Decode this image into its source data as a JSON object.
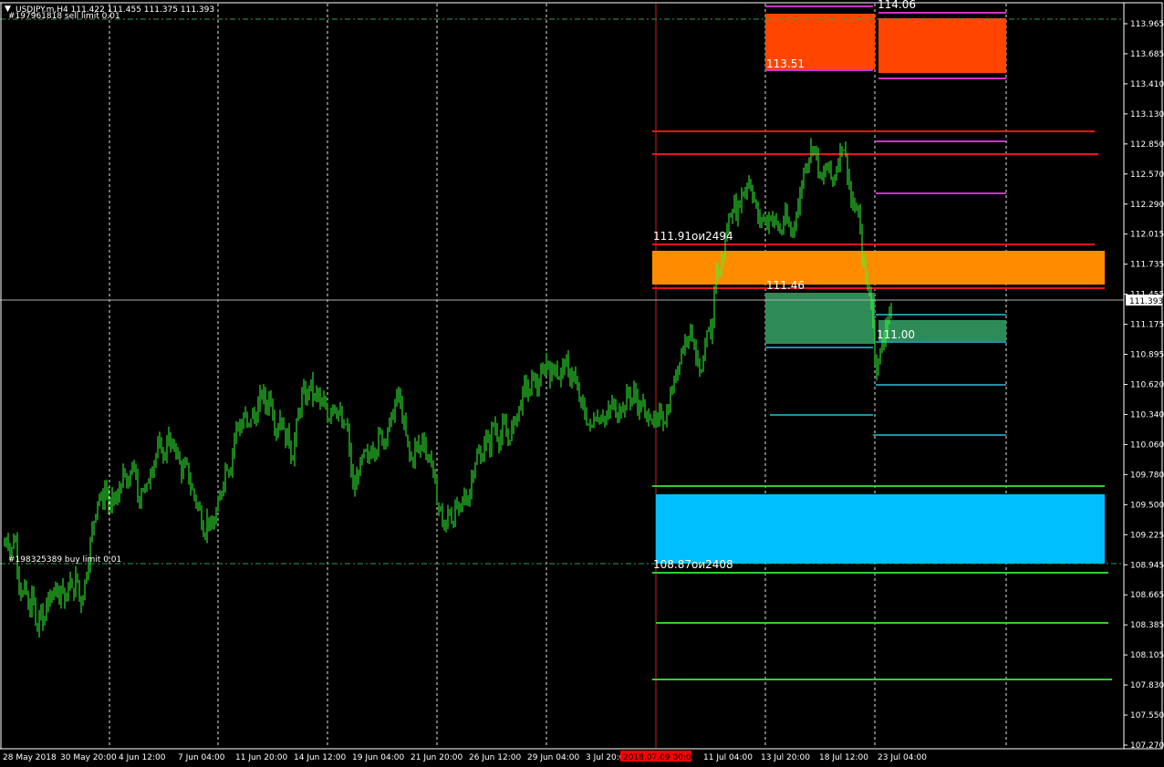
{
  "header": {
    "menu_glyph": "▼",
    "symbol_line": "USDJPY.m,H4  111.422 111.455 111.375 111.393"
  },
  "orders": {
    "sell_limit": "#197961818 sell limit 0.01",
    "buy_limit": "#198325389 buy limit 0.01"
  },
  "current_price": "111.393",
  "colors": {
    "background": "#000000",
    "candles": "#33ff33",
    "axis": "#ffffff",
    "grid": "#ffffff",
    "order_line": "#2d9e4f",
    "red_line": "#e8141b",
    "sell_zone": "#ff4500",
    "orange_zone": "#ff8c00",
    "green_zone": "#2e8b57",
    "blue_zone": "#00bfff",
    "magenta_line": "#cc33cc",
    "teal_line": "#1e90a6",
    "green_line": "#32cd32",
    "date_marker": "#ff0000"
  },
  "chart_data": {
    "type": "candlestick",
    "symbol": "USDJPY.m",
    "timeframe": "H4",
    "ohlc_last": {
      "open": 111.422,
      "high": 111.455,
      "low": 111.375,
      "close": 111.393
    },
    "ylim": [
      107.27,
      114.245
    ],
    "y_ticks": [
      "113.965",
      "113.685",
      "113.410",
      "113.130",
      "112.850",
      "112.570",
      "112.290",
      "112.015",
      "111.735",
      "111.455",
      "111.175",
      "110.895",
      "110.620",
      "110.340",
      "110.060",
      "109.780",
      "109.500",
      "109.225",
      "108.945",
      "108.665",
      "108.385",
      "108.105",
      "107.830",
      "107.550",
      "107.270"
    ],
    "x_ticks": [
      "28 May 2018",
      "30 May 20:00",
      "4 Jun 12:00",
      "7 Jun 04:00",
      "11 Jun 20:00",
      "14 Jun 12:00",
      "19 Jun 04:00",
      "21 Jun 20:00",
      "26 Jun 12:00",
      "29 Jun 04:00",
      "3 Jul 20:00",
      "11 Jul 04:00",
      "13 Jul 20:00",
      "18 Jul 12:00",
      "23 Jul 04:00"
    ],
    "date_marker": "2018.07.09 00:00",
    "price_path": [
      [
        0,
        109.4
      ],
      [
        4,
        109.2
      ],
      [
        8,
        109.3
      ],
      [
        12,
        109.1
      ],
      [
        16,
        109.35
      ],
      [
        20,
        108.9
      ],
      [
        24,
        108.7
      ],
      [
        28,
        108.8
      ],
      [
        32,
        108.5
      ],
      [
        36,
        108.8
      ],
      [
        40,
        108.3
      ],
      [
        44,
        108.6
      ],
      [
        48,
        108.4
      ],
      [
        52,
        108.75
      ],
      [
        56,
        108.6
      ],
      [
        60,
        108.9
      ],
      [
        64,
        108.7
      ],
      [
        68,
        108.85
      ],
      [
        72,
        108.6
      ],
      [
        76,
        108.9
      ],
      [
        80,
        108.7
      ],
      [
        84,
        108.95
      ],
      [
        88,
        108.6
      ],
      [
        92,
        108.8
      ],
      [
        96,
        109.0
      ],
      [
        100,
        109.3
      ],
      [
        104,
        109.5
      ],
      [
        108,
        109.7
      ],
      [
        112,
        109.6
      ],
      [
        116,
        109.8
      ],
      [
        120,
        109.5
      ],
      [
        124,
        109.7
      ],
      [
        128,
        109.6
      ],
      [
        132,
        109.8
      ],
      [
        136,
        109.9
      ],
      [
        140,
        109.7
      ],
      [
        144,
        110.0
      ],
      [
        148,
        109.9
      ],
      [
        152,
        109.6
      ],
      [
        156,
        109.8
      ],
      [
        160,
        109.7
      ],
      [
        164,
        109.9
      ],
      [
        168,
        110.0
      ],
      [
        172,
        110.1
      ],
      [
        176,
        110.2
      ],
      [
        180,
        110.0
      ],
      [
        184,
        110.3
      ],
      [
        188,
        110.1
      ],
      [
        192,
        110.2
      ],
      [
        196,
        110.0
      ],
      [
        200,
        109.9
      ],
      [
        204,
        110.0
      ],
      [
        208,
        109.8
      ],
      [
        212,
        109.7
      ],
      [
        216,
        109.6
      ],
      [
        220,
        109.5
      ],
      [
        224,
        109.3
      ],
      [
        228,
        109.5
      ],
      [
        232,
        109.3
      ],
      [
        236,
        109.5
      ],
      [
        240,
        109.6
      ],
      [
        244,
        109.8
      ],
      [
        248,
        110.0
      ],
      [
        252,
        109.9
      ],
      [
        256,
        110.2
      ],
      [
        260,
        110.4
      ],
      [
        264,
        110.3
      ],
      [
        268,
        110.5
      ],
      [
        272,
        110.3
      ],
      [
        276,
        110.5
      ],
      [
        280,
        110.4
      ],
      [
        284,
        110.6
      ],
      [
        288,
        110.7
      ],
      [
        292,
        110.5
      ],
      [
        296,
        110.7
      ],
      [
        300,
        110.4
      ],
      [
        304,
        110.3
      ],
      [
        308,
        110.5
      ],
      [
        312,
        110.2
      ],
      [
        316,
        110.3
      ],
      [
        320,
        110.0
      ],
      [
        324,
        110.3
      ],
      [
        328,
        110.5
      ],
      [
        332,
        110.7
      ],
      [
        336,
        110.6
      ],
      [
        340,
        110.8
      ],
      [
        344,
        110.6
      ],
      [
        348,
        110.7
      ],
      [
        352,
        110.5
      ],
      [
        356,
        110.6
      ],
      [
        360,
        110.4
      ],
      [
        364,
        110.6
      ],
      [
        368,
        110.5
      ],
      [
        372,
        110.5
      ],
      [
        376,
        110.3
      ],
      [
        380,
        110.4
      ],
      [
        384,
        110.0
      ],
      [
        388,
        109.7
      ],
      [
        392,
        109.9
      ],
      [
        396,
        110.0
      ],
      [
        400,
        110.1
      ],
      [
        404,
        110.0
      ],
      [
        408,
        110.2
      ],
      [
        412,
        110.1
      ],
      [
        416,
        110.3
      ],
      [
        420,
        110.2
      ],
      [
        424,
        110.3
      ],
      [
        428,
        110.4
      ],
      [
        432,
        110.5
      ],
      [
        436,
        110.7
      ],
      [
        440,
        110.5
      ],
      [
        444,
        110.3
      ],
      [
        448,
        110.1
      ],
      [
        452,
        110.0
      ],
      [
        456,
        110.2
      ],
      [
        460,
        110.1
      ],
      [
        464,
        110.3
      ],
      [
        468,
        110.0
      ],
      [
        472,
        110.1
      ],
      [
        476,
        109.8
      ],
      [
        480,
        109.6
      ],
      [
        484,
        109.5
      ],
      [
        488,
        109.3
      ],
      [
        492,
        109.6
      ],
      [
        496,
        109.4
      ],
      [
        500,
        109.6
      ],
      [
        504,
        109.5
      ],
      [
        508,
        109.7
      ],
      [
        512,
        109.6
      ],
      [
        516,
        109.8
      ],
      [
        520,
        110.0
      ],
      [
        524,
        110.1
      ],
      [
        528,
        110.0
      ],
      [
        532,
        110.3
      ],
      [
        536,
        110.1
      ],
      [
        540,
        110.4
      ],
      [
        544,
        110.3
      ],
      [
        548,
        110.2
      ],
      [
        552,
        110.4
      ],
      [
        556,
        110.2
      ],
      [
        560,
        110.3
      ],
      [
        564,
        110.4
      ],
      [
        568,
        110.5
      ],
      [
        572,
        110.6
      ],
      [
        576,
        110.8
      ],
      [
        580,
        110.6
      ],
      [
        584,
        110.9
      ],
      [
        588,
        110.7
      ],
      [
        592,
        110.8
      ],
      [
        596,
        110.9
      ],
      [
        600,
        111.0
      ],
      [
        604,
        110.8
      ],
      [
        608,
        111.0
      ],
      [
        612,
        110.8
      ],
      [
        616,
        110.9
      ],
      [
        620,
        111.0
      ],
      [
        624,
        110.8
      ],
      [
        628,
        110.9
      ],
      [
        632,
        110.7
      ],
      [
        636,
        110.6
      ],
      [
        640,
        110.5
      ],
      [
        644,
        110.4
      ],
      [
        648,
        110.3
      ],
      [
        652,
        110.5
      ],
      [
        656,
        110.4
      ],
      [
        660,
        110.5
      ],
      [
        664,
        110.4
      ],
      [
        668,
        110.5
      ],
      [
        672,
        110.6
      ],
      [
        676,
        110.4
      ],
      [
        680,
        110.6
      ],
      [
        684,
        110.5
      ],
      [
        688,
        110.7
      ],
      [
        692,
        110.6
      ],
      [
        696,
        110.7
      ],
      [
        700,
        110.5
      ],
      [
        704,
        110.6
      ],
      [
        708,
        110.4
      ],
      [
        712,
        110.5
      ],
      [
        716,
        110.4
      ],
      [
        720,
        110.35
      ],
      [
        724,
        110.5
      ],
      [
        728,
        110.4
      ],
      [
        732,
        110.5
      ],
      [
        736,
        110.7
      ],
      [
        740,
        110.8
      ],
      [
        744,
        111.0
      ],
      [
        748,
        111.1
      ],
      [
        752,
        111.2
      ],
      [
        756,
        111.3
      ],
      [
        760,
        111.2
      ],
      [
        764,
        111.0
      ],
      [
        768,
        110.8
      ],
      [
        772,
        111.0
      ],
      [
        776,
        111.3
      ],
      [
        780,
        111.2
      ],
      [
        784,
        111.9
      ],
      [
        788,
        111.8
      ],
      [
        792,
        112.0
      ],
      [
        796,
        112.2
      ],
      [
        800,
        112.4
      ],
      [
        804,
        112.5
      ],
      [
        808,
        112.4
      ],
      [
        812,
        112.6
      ],
      [
        816,
        112.6
      ],
      [
        820,
        112.75
      ],
      [
        824,
        112.65
      ],
      [
        828,
        112.5
      ],
      [
        832,
        112.3
      ],
      [
        836,
        112.4
      ],
      [
        840,
        112.3
      ],
      [
        844,
        112.4
      ],
      [
        848,
        112.35
      ],
      [
        852,
        112.3
      ],
      [
        856,
        112.2
      ],
      [
        860,
        112.4
      ],
      [
        864,
        112.3
      ],
      [
        868,
        112.2
      ],
      [
        872,
        112.4
      ],
      [
        876,
        112.5
      ],
      [
        880,
        112.8
      ],
      [
        884,
        112.9
      ],
      [
        888,
        113.0
      ],
      [
        892,
        113.1
      ],
      [
        896,
        112.9
      ],
      [
        900,
        112.7
      ],
      [
        904,
        112.8
      ],
      [
        908,
        112.9
      ],
      [
        912,
        112.7
      ],
      [
        916,
        112.8
      ],
      [
        920,
        113.0
      ],
      [
        924,
        113.1
      ],
      [
        928,
        112.9
      ],
      [
        932,
        112.6
      ],
      [
        936,
        112.4
      ],
      [
        940,
        112.5
      ],
      [
        944,
        112.1
      ],
      [
        948,
        111.8
      ],
      [
        952,
        111.7
      ],
      [
        956,
        111.5
      ],
      [
        960,
        110.9
      ],
      [
        964,
        111.0
      ],
      [
        968,
        111.2
      ],
      [
        972,
        111.4
      ],
      [
        976,
        111.45
      ],
      [
        980,
        111.39
      ]
    ],
    "annotations": [
      {
        "label": "114.06",
        "type": "level"
      },
      {
        "label": "113.51",
        "type": "level"
      },
      {
        "label": "111.91ои2494",
        "type": "level"
      },
      {
        "label": "111.46",
        "type": "level"
      },
      {
        "label": "111.00",
        "type": "level"
      },
      {
        "label": "108.87ои2408",
        "type": "level"
      }
    ],
    "zones": [
      {
        "name": "sell-zone-left",
        "from": 113.51,
        "to": 114.0
      },
      {
        "name": "sell-zone-right",
        "from": 113.5,
        "to": 113.95
      },
      {
        "name": "orange-zone",
        "from": 111.5,
        "to": 111.85
      },
      {
        "name": "green-zone-left",
        "from": 111.03,
        "to": 111.46
      },
      {
        "name": "green-zone-right",
        "from": 111.08,
        "to": 111.2
      },
      {
        "name": "blue-zone",
        "from": 108.95,
        "to": 109.6
      }
    ],
    "sell_limit_price": 113.965,
    "buy_limit_price": 108.945,
    "current_price_value": 111.393
  }
}
